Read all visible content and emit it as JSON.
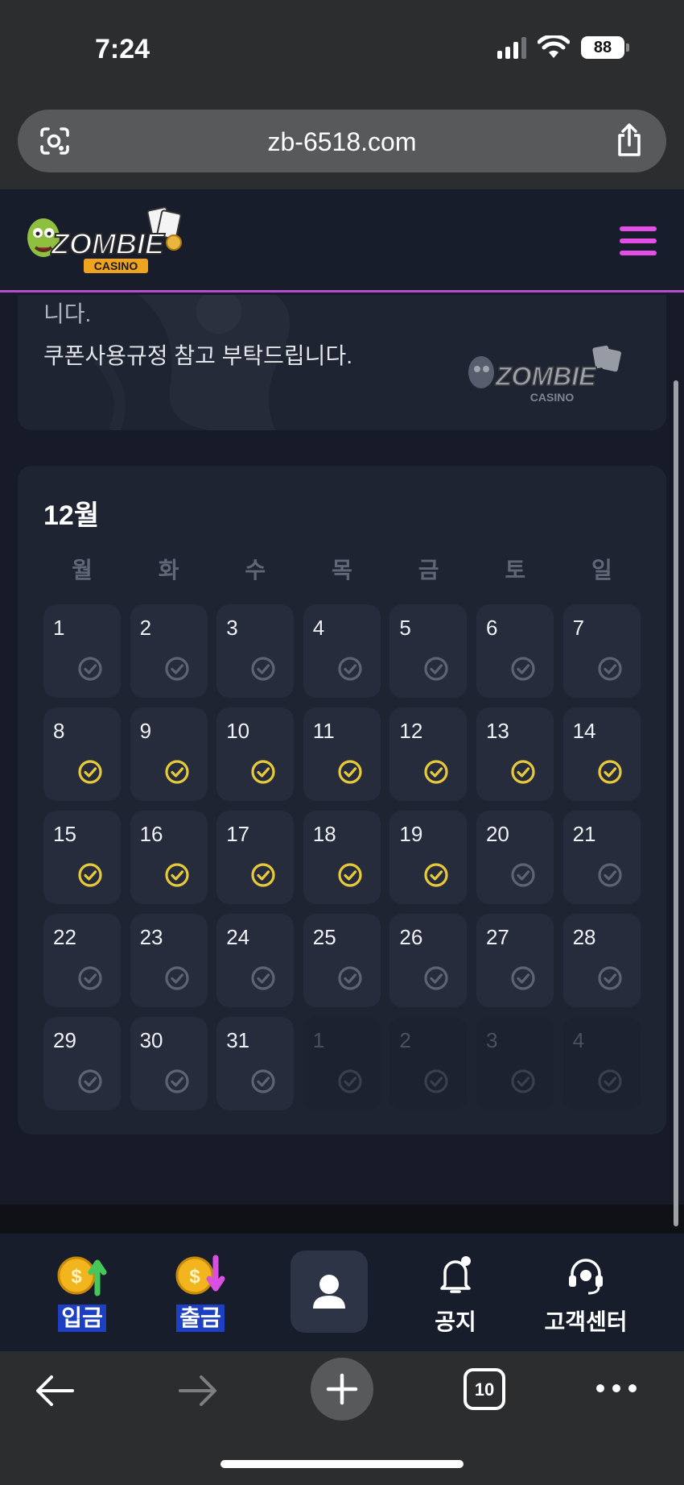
{
  "status_bar": {
    "time": "7:24",
    "battery": "88"
  },
  "browser": {
    "url": "zb-6518.com",
    "tabs_count": "10"
  },
  "header": {
    "logo_text": "ZOMBIE",
    "logo_subtext": "CASINO"
  },
  "notice": {
    "line1": "니다.",
    "line2": "쿠폰사용규정 참고 부탁드립니다.",
    "logo_text": "ZOMBIE",
    "logo_subtext": "CASINO"
  },
  "calendar": {
    "month": "12월",
    "weekdays": [
      "월",
      "화",
      "수",
      "목",
      "금",
      "토",
      "일"
    ],
    "days": [
      {
        "n": "1",
        "s": "past"
      },
      {
        "n": "2",
        "s": "past"
      },
      {
        "n": "3",
        "s": "past"
      },
      {
        "n": "4",
        "s": "past"
      },
      {
        "n": "5",
        "s": "past"
      },
      {
        "n": "6",
        "s": "past"
      },
      {
        "n": "7",
        "s": "past"
      },
      {
        "n": "8",
        "s": "checked"
      },
      {
        "n": "9",
        "s": "checked"
      },
      {
        "n": "10",
        "s": "checked"
      },
      {
        "n": "11",
        "s": "checked"
      },
      {
        "n": "12",
        "s": "checked"
      },
      {
        "n": "13",
        "s": "checked"
      },
      {
        "n": "14",
        "s": "checked"
      },
      {
        "n": "15",
        "s": "checked"
      },
      {
        "n": "16",
        "s": "checked"
      },
      {
        "n": "17",
        "s": "checked"
      },
      {
        "n": "18",
        "s": "checked"
      },
      {
        "n": "19",
        "s": "checked"
      },
      {
        "n": "20",
        "s": "past"
      },
      {
        "n": "21",
        "s": "past"
      },
      {
        "n": "22",
        "s": "past"
      },
      {
        "n": "23",
        "s": "past"
      },
      {
        "n": "24",
        "s": "past"
      },
      {
        "n": "25",
        "s": "past"
      },
      {
        "n": "26",
        "s": "past"
      },
      {
        "n": "27",
        "s": "past"
      },
      {
        "n": "28",
        "s": "past"
      },
      {
        "n": "29",
        "s": "past"
      },
      {
        "n": "30",
        "s": "past"
      },
      {
        "n": "31",
        "s": "past"
      },
      {
        "n": "1",
        "s": "outside"
      },
      {
        "n": "2",
        "s": "outside"
      },
      {
        "n": "3",
        "s": "outside"
      },
      {
        "n": "4",
        "s": "outside"
      }
    ]
  },
  "bottom_nav": {
    "deposit": "입금",
    "withdraw": "출금",
    "notice": "공지",
    "support": "고객센터"
  },
  "colors": {
    "accent_magenta": "#e34fe6",
    "check_gold": "#e7c93a",
    "check_gray": "#5d6371",
    "card_bg": "#1f2433"
  },
  "icons": {
    "deposit": "coin-arrow-up-icon",
    "withdraw": "coin-arrow-down-icon",
    "profile": "user-icon",
    "notice": "bell-icon",
    "support": "headset-icon"
  }
}
